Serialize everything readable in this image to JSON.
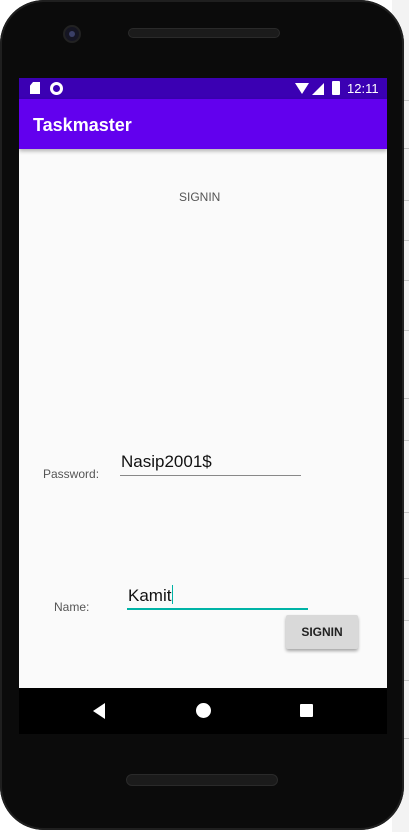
{
  "status_bar": {
    "time": "12:11",
    "icons": [
      "sd-card-icon",
      "circle-notification-icon",
      "wifi-icon",
      "signal-icon",
      "battery-icon"
    ]
  },
  "app_bar": {
    "title": "Taskmaster",
    "color": "#6200ee"
  },
  "main": {
    "heading": "SIGNIN",
    "password_label": "Password:",
    "password_value": "Nasip2001$",
    "name_label": "Name:",
    "name_value": "Kamit",
    "signin_button_label": "SIGNIN"
  },
  "colors": {
    "status_bar": "#3b00b3",
    "accent": "#00b3a6",
    "background": "#fafafa"
  },
  "nav_bar": {
    "icons": [
      "back-icon",
      "home-icon",
      "recents-icon"
    ]
  }
}
